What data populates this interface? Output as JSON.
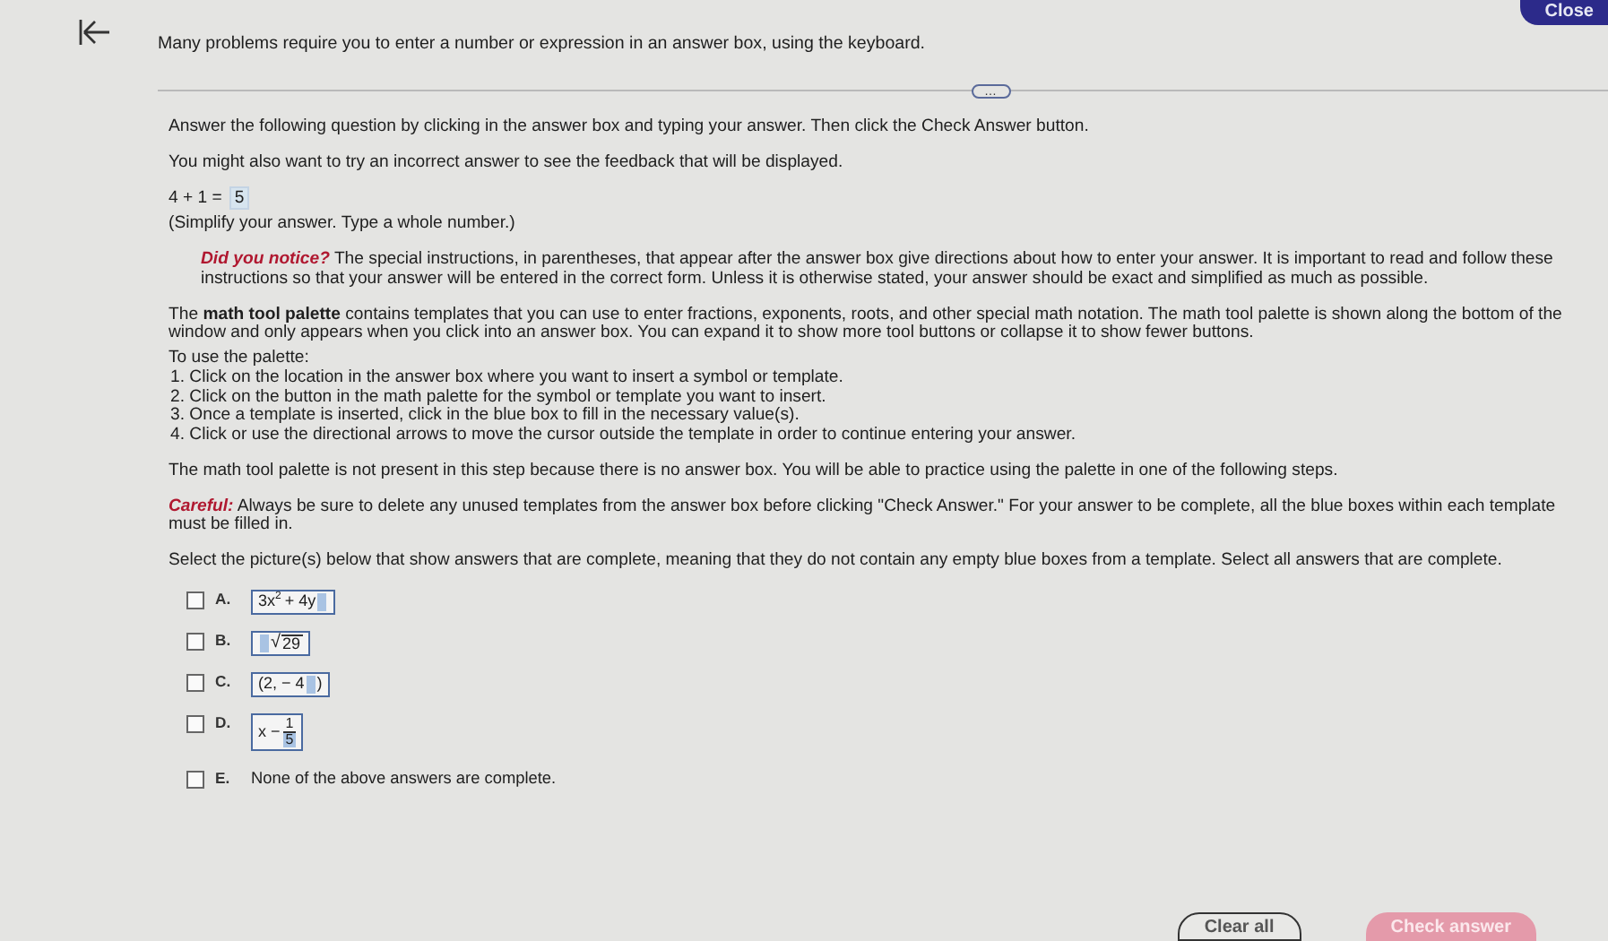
{
  "header": {
    "intro": "Many problems require you to enter a number or expression in an answer box, using the keyboard.",
    "close": "Close"
  },
  "more": "…",
  "paragraphs": [
    {
      "kind": "plain",
      "text": "Answer the following question by clicking in the answer box and typing your answer. Then click the Check Answer button."
    },
    {
      "kind": "plain",
      "text": "You might also want to try an incorrect answer to see the feedback that will be displayed."
    }
  ],
  "example": {
    "question": "4 + 1 =",
    "answer": "5",
    "hint": "(Simplify your answer. Type a whole number.)"
  },
  "notice_lead": "Did you notice?",
  "notice": " The special instructions, in parentheses, that appear after the answer box give directions about how to enter your answer. It is important to read and follow these instructions so that your answer will be entered in the correct form. Unless it is otherwise stated, your answer should be exact and simplified as much as possible.",
  "palette_text": "The **math tool palette** contains templates that you can use to enter fractions, exponents, roots, and other special math notation. The math tool palette is shown along the bottom of the window and only appears when you click into an answer box. You can expand it to show more tool buttons or collapse it to show fewer buttons.",
  "steps_title": "To use the palette:",
  "steps": [
    "1. Click on the location in the answer box where you want to insert a symbol or template.",
    "2. Click on the button in the math palette for the symbol or template you want to insert.",
    "3. Once a template is inserted, click in the blue box to fill in the necessary value(s).",
    "4. Click or use the directional arrows to move the cursor outside the template in order to continue entering your answer."
  ],
  "no_palette": "The math tool palette is not present in this step because there is no answer box. You will be able to practice using the palette in one of the following steps.",
  "careful_lead": "Careful:",
  "careful": " Always be sure to delete any unused templates from the answer box before clicking \"Check Answer.\" For your answer to be complete, all the blue boxes within each template must be filled in.",
  "question": "Select the picture(s) below that show answers that are complete, meaning that they do not contain any empty blue boxes from a template. Select all answers that are complete.",
  "options": [
    {
      "letter": "A.",
      "checked": false,
      "kind": "math",
      "parts": [
        {
          "kind": "text",
          "text": "3x"
        },
        {
          "kind": "sup",
          "text": "2"
        },
        {
          "kind": "text",
          "text": " + 4y"
        },
        {
          "kind": "blank"
        }
      ]
    },
    {
      "letter": "B.",
      "checked": false,
      "kind": "math",
      "parts": [
        {
          "kind": "blank"
        },
        {
          "kind": "sqrt",
          "symbol": "√",
          "text": "29"
        }
      ]
    },
    {
      "letter": "C.",
      "checked": false,
      "kind": "math",
      "parts": [
        {
          "kind": "text",
          "text": "(2, − 4"
        },
        {
          "kind": "blank"
        },
        {
          "kind": "text",
          "text": ")"
        }
      ]
    },
    {
      "letter": "D.",
      "checked": false,
      "kind": "math",
      "parts": [
        {
          "kind": "text",
          "text": "x − "
        },
        {
          "kind": "frac",
          "num": "1",
          "den": "5"
        }
      ]
    },
    {
      "letter": "E.",
      "checked": false,
      "kind": "text",
      "text": "None of the above answers are complete."
    }
  ],
  "buttons": [
    {
      "label": "Clear all",
      "kind": "outline"
    },
    {
      "label": "Check answer",
      "kind": "primary",
      "disabled": true
    }
  ]
}
